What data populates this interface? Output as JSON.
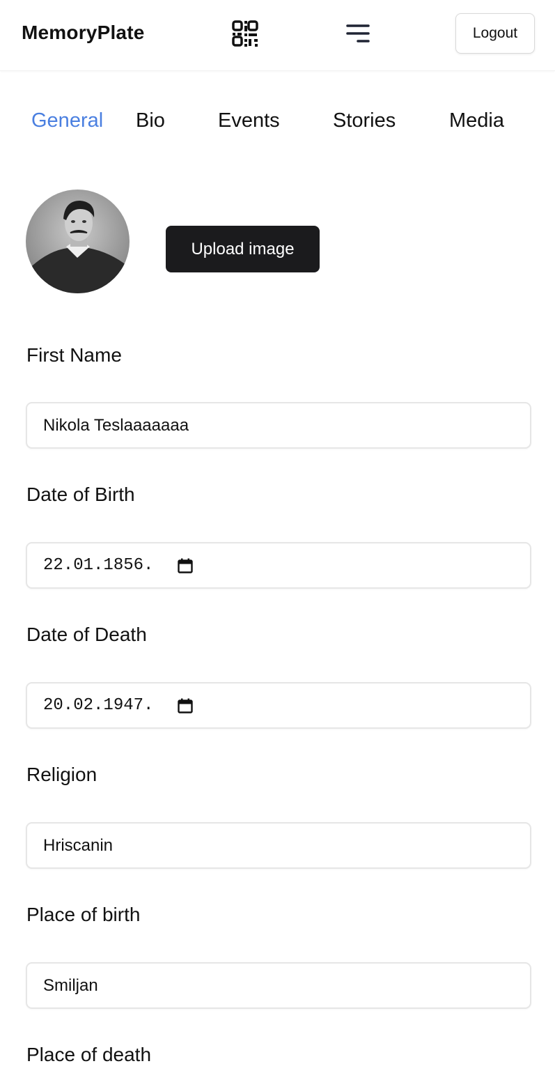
{
  "header": {
    "brand": "MemoryPlate",
    "logout_label": "Logout",
    "icons": [
      "qr-code-icon",
      "menu-icon"
    ]
  },
  "tabs": [
    {
      "label": "General",
      "active": true
    },
    {
      "label": "Bio",
      "active": false
    },
    {
      "label": "Events",
      "active": false
    },
    {
      "label": "Stories",
      "active": false
    },
    {
      "label": "Media",
      "active": false
    }
  ],
  "profile": {
    "upload_label": "Upload image"
  },
  "form": {
    "first_name": {
      "label": "First Name",
      "value": "Nikola Teslaaaaaaa"
    },
    "date_of_birth": {
      "label": "Date of Birth",
      "value": "22.01.1856."
    },
    "date_of_death": {
      "label": "Date of Death",
      "value": "20.02.1947."
    },
    "religion": {
      "label": "Religion",
      "value": "Hriscanin"
    },
    "place_of_birth": {
      "label": "Place of birth",
      "value": "Smiljan"
    },
    "place_of_death": {
      "label": "Place of death"
    }
  },
  "colors": {
    "accent": "#4a7fe0",
    "button_dark": "#1b1b1d",
    "border": "#e6e6e6"
  }
}
